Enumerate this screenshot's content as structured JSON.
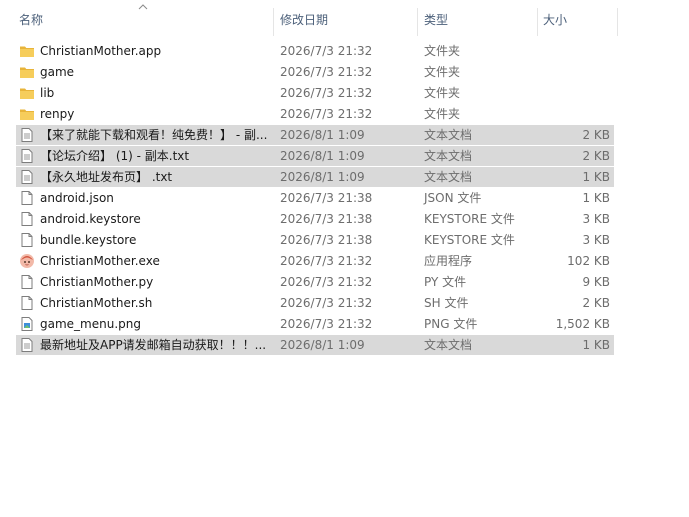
{
  "columns": {
    "name": "名称",
    "date": "修改日期",
    "type": "类型",
    "size": "大小"
  },
  "files": [
    {
      "name": "ChristianMother.app",
      "date": "2026/7/3 21:32",
      "type": "文件夹",
      "size": "",
      "icon": "folder-icon",
      "selected": false
    },
    {
      "name": "game",
      "date": "2026/7/3 21:32",
      "type": "文件夹",
      "size": "",
      "icon": "folder-icon",
      "selected": false
    },
    {
      "name": "lib",
      "date": "2026/7/3 21:32",
      "type": "文件夹",
      "size": "",
      "icon": "folder-icon",
      "selected": false
    },
    {
      "name": "renpy",
      "date": "2026/7/3 21:32",
      "type": "文件夹",
      "size": "",
      "icon": "folder-icon",
      "selected": false
    },
    {
      "name": "【来了就能下载和观看！纯免费！】 - 副...",
      "date": "2026/8/1 1:09",
      "type": "文本文档",
      "size": "2 KB",
      "icon": "text-file-icon",
      "selected": true
    },
    {
      "name": "【论坛介绍】 (1) - 副本.txt",
      "date": "2026/8/1 1:09",
      "type": "文本文档",
      "size": "2 KB",
      "icon": "text-file-icon",
      "selected": true
    },
    {
      "name": "【永久地址发布页】 .txt",
      "date": "2026/8/1 1:09",
      "type": "文本文档",
      "size": "1 KB",
      "icon": "text-file-icon",
      "selected": true
    },
    {
      "name": "android.json",
      "date": "2026/7/3 21:38",
      "type": "JSON 文件",
      "size": "1 KB",
      "icon": "file-icon",
      "selected": false
    },
    {
      "name": "android.keystore",
      "date": "2026/7/3 21:38",
      "type": "KEYSTORE 文件",
      "size": "3 KB",
      "icon": "file-icon",
      "selected": false
    },
    {
      "name": "bundle.keystore",
      "date": "2026/7/3 21:38",
      "type": "KEYSTORE 文件",
      "size": "3 KB",
      "icon": "file-icon",
      "selected": false
    },
    {
      "name": "ChristianMother.exe",
      "date": "2026/7/3 21:32",
      "type": "应用程序",
      "size": "102 KB",
      "icon": "app-icon",
      "selected": false
    },
    {
      "name": "ChristianMother.py",
      "date": "2026/7/3 21:32",
      "type": "PY 文件",
      "size": "9 KB",
      "icon": "file-icon",
      "selected": false
    },
    {
      "name": "ChristianMother.sh",
      "date": "2026/7/3 21:32",
      "type": "SH 文件",
      "size": "2 KB",
      "icon": "file-icon",
      "selected": false
    },
    {
      "name": "game_menu.png",
      "date": "2026/7/3 21:32",
      "type": "PNG 文件",
      "size": "1,502 KB",
      "icon": "image-file-icon",
      "selected": false
    },
    {
      "name": "最新地址及APP请发邮箱自动获取！！！...",
      "date": "2026/8/1 1:09",
      "type": "文本文档",
      "size": "1 KB",
      "icon": "text-file-icon",
      "selected": true
    }
  ],
  "colors": {
    "selected_row": "#d9d9d9",
    "folder": "#f4c64f",
    "header_text": "#4c607a"
  }
}
